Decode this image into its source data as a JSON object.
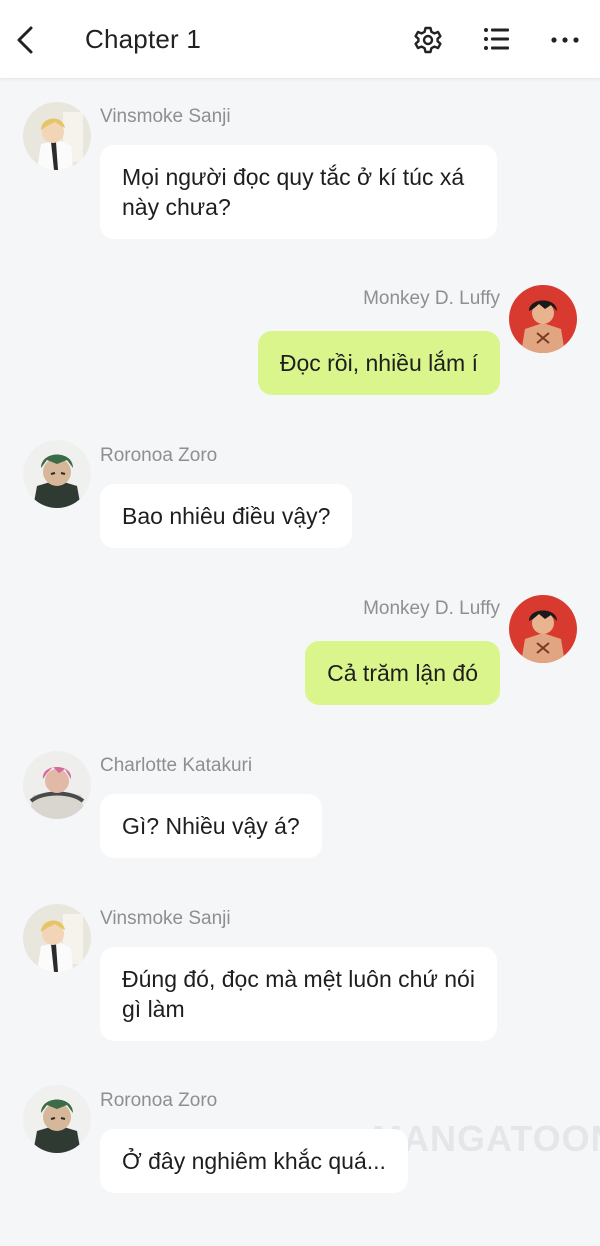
{
  "header": {
    "title": "Chapter 1",
    "back_icon": "chevron-left-icon",
    "settings_icon": "gear-icon",
    "list_icon": "list-icon",
    "more_icon": "more-horizontal-icon"
  },
  "messages": [
    {
      "sender": "Vinsmoke Sanji",
      "side": "left",
      "text": "Mọi người đọc quy tắc ở kí túc xá này chưa?"
    },
    {
      "sender": "Monkey D. Luffy",
      "side": "right",
      "text": "Đọc rồi, nhiều lắm í"
    },
    {
      "sender": "Roronoa Zoro",
      "side": "left",
      "text": "Bao nhiêu điều vậy?"
    },
    {
      "sender": "Monkey D. Luffy",
      "side": "right",
      "text": "Cả trăm lận đó"
    },
    {
      "sender": "Charlotte Katakuri",
      "side": "left",
      "text": "Gì? Nhiều vậy á?"
    },
    {
      "sender": "Vinsmoke Sanji",
      "side": "left",
      "text": "Đúng đó, đọc mà mệt luôn chứ nói gì làm"
    },
    {
      "sender": "Roronoa Zoro",
      "side": "left",
      "text": "Ở đây nghiêm khắc quá..."
    }
  ],
  "watermark": "MANGATOON",
  "colors": {
    "background": "#f5f6f8",
    "left_bubble": "#ffffff",
    "right_bubble": "#d9f58c",
    "sender_text": "#8e8e93"
  }
}
